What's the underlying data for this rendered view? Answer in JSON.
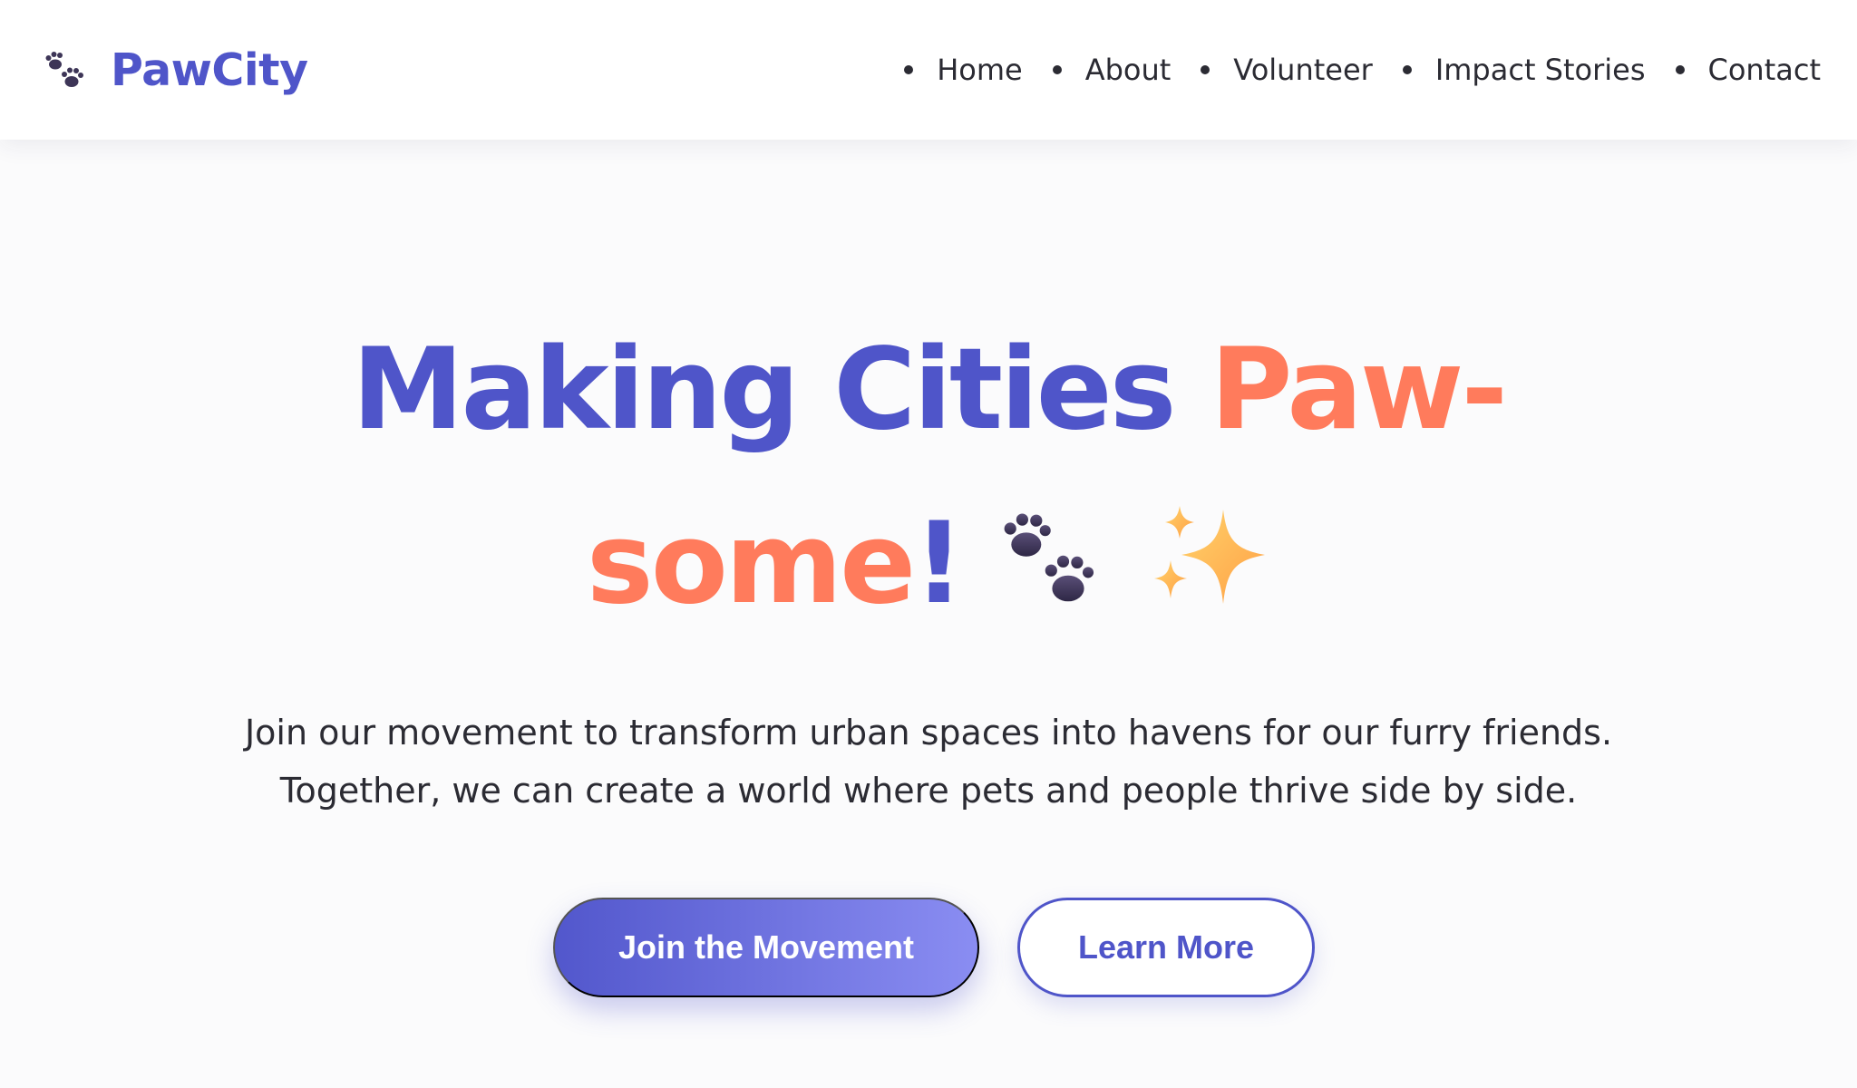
{
  "colors": {
    "brand_blue": "#4f55c9",
    "accent_coral": "#ff7b5c",
    "text_dark": "#2b2b33",
    "background": "#fbfbfc",
    "button_gradient_start": "#5257cc",
    "button_gradient_end": "#8a8df2"
  },
  "header": {
    "logo_icon": "paw-prints-icon",
    "brand_name": "PawCity",
    "nav": [
      {
        "label": "Home"
      },
      {
        "label": "About"
      },
      {
        "label": "Volunteer"
      },
      {
        "label": "Impact Stories"
      },
      {
        "label": "Contact"
      }
    ]
  },
  "hero": {
    "title_part1": "Making Cities ",
    "title_part2": "Paw-some",
    "title_part3": "!",
    "title_icons": [
      "paw-prints-icon",
      "sparkles-icon"
    ],
    "subtitle_line1": "Join our movement to transform urban spaces into havens for our furry friends.",
    "subtitle_line2": "Together, we can create a world where pets and people thrive side by side.",
    "primary_button": "Join the Movement",
    "secondary_button": "Learn More"
  }
}
